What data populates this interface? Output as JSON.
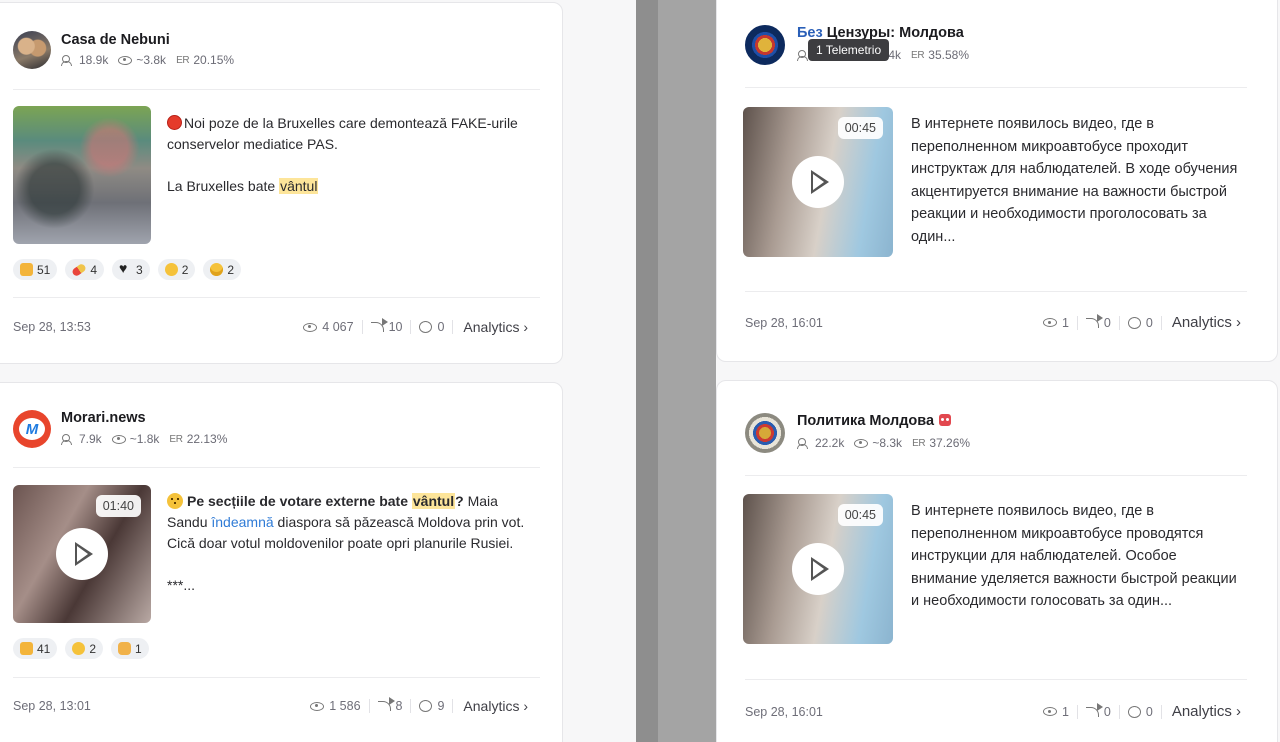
{
  "left_posts": [
    {
      "channel": "Casa de Nebuni",
      "subscribers": "18.9k",
      "views_avg": "~3.8k",
      "er_label": "ER",
      "er": "20.15%",
      "text_p1_prefix": "Noi poze de la Bruxelles care demontează FAKE-urile conservelor mediatice PAS.",
      "text_p2_prefix": "La Bruxelles bate ",
      "text_p2_highlight": "vântul",
      "reactions": [
        {
          "icon": "thumbs-up-icon",
          "count": "51"
        },
        {
          "icon": "pill-icon",
          "count": "4"
        },
        {
          "icon": "heart-icon",
          "count": "3"
        },
        {
          "icon": "grin-icon",
          "count": "2"
        },
        {
          "icon": "shocked-face-icon",
          "count": "2"
        }
      ],
      "date": "Sep 28, 13:53",
      "views": "4 067",
      "shares": "10",
      "comments": "0",
      "analytics": "Analytics ›"
    },
    {
      "channel": "Morari.news",
      "subscribers": "7.9k",
      "views_avg": "~1.8k",
      "er_label": "ER",
      "er": "22.13%",
      "duration": "01:40",
      "text_bold_1": "Pe secțiile de votare externe bate ",
      "text_highlight": "vântul",
      "text_bold_2": "?",
      "text_rest_1": " Maia Sandu ",
      "text_link": "îndeamnă",
      "text_rest_2": " diaspora să păzească Moldova prin vot. Cică doar votul moldovenilor poate opri planurile Rusiei.",
      "text_more": "***...",
      "reactions": [
        {
          "icon": "thumbs-down-icon",
          "count": "41"
        },
        {
          "icon": "grin-icon",
          "count": "2"
        },
        {
          "icon": "fist-icon",
          "count": "1"
        }
      ],
      "date": "Sep 28, 13:01",
      "views": "1 586",
      "shares": "8",
      "comments": "9",
      "analytics": "Analytics ›"
    }
  ],
  "right_posts": [
    {
      "channel_prefix": "Без",
      "channel_rest": " Цензуры: Молдова",
      "subscribers_visible": "4k",
      "er_label": "ER",
      "er": "35.58%",
      "duration": "00:45",
      "text": "В интернете появилось видео, где в переполненном микроавтобусе проходит инструктаж для наблюдателей. В ходе обучения акцентируется внимание на важности быстрой реакции и необходимости проголосовать за один...",
      "date": "Sep 28, 16:01",
      "views": "1",
      "shares": "0",
      "comments": "0",
      "analytics": "Analytics ›"
    },
    {
      "channel": "Политика Молдова",
      "subscribers": "22.2k",
      "views_avg": "~8.3k",
      "er_label": "ER",
      "er": "37.26%",
      "duration": "00:45",
      "text": "В интернете появилось видео, где в переполненном микроавтобусе проводятся инструкции для наблюдателей. Особое внимание уделяется важности быстрой реакции и необходимости голосовать за один...",
      "date": "Sep 28, 16:01",
      "views": "1",
      "shares": "0",
      "comments": "0",
      "analytics": "Analytics ›"
    }
  ],
  "tooltip": "1 Telemetrio"
}
